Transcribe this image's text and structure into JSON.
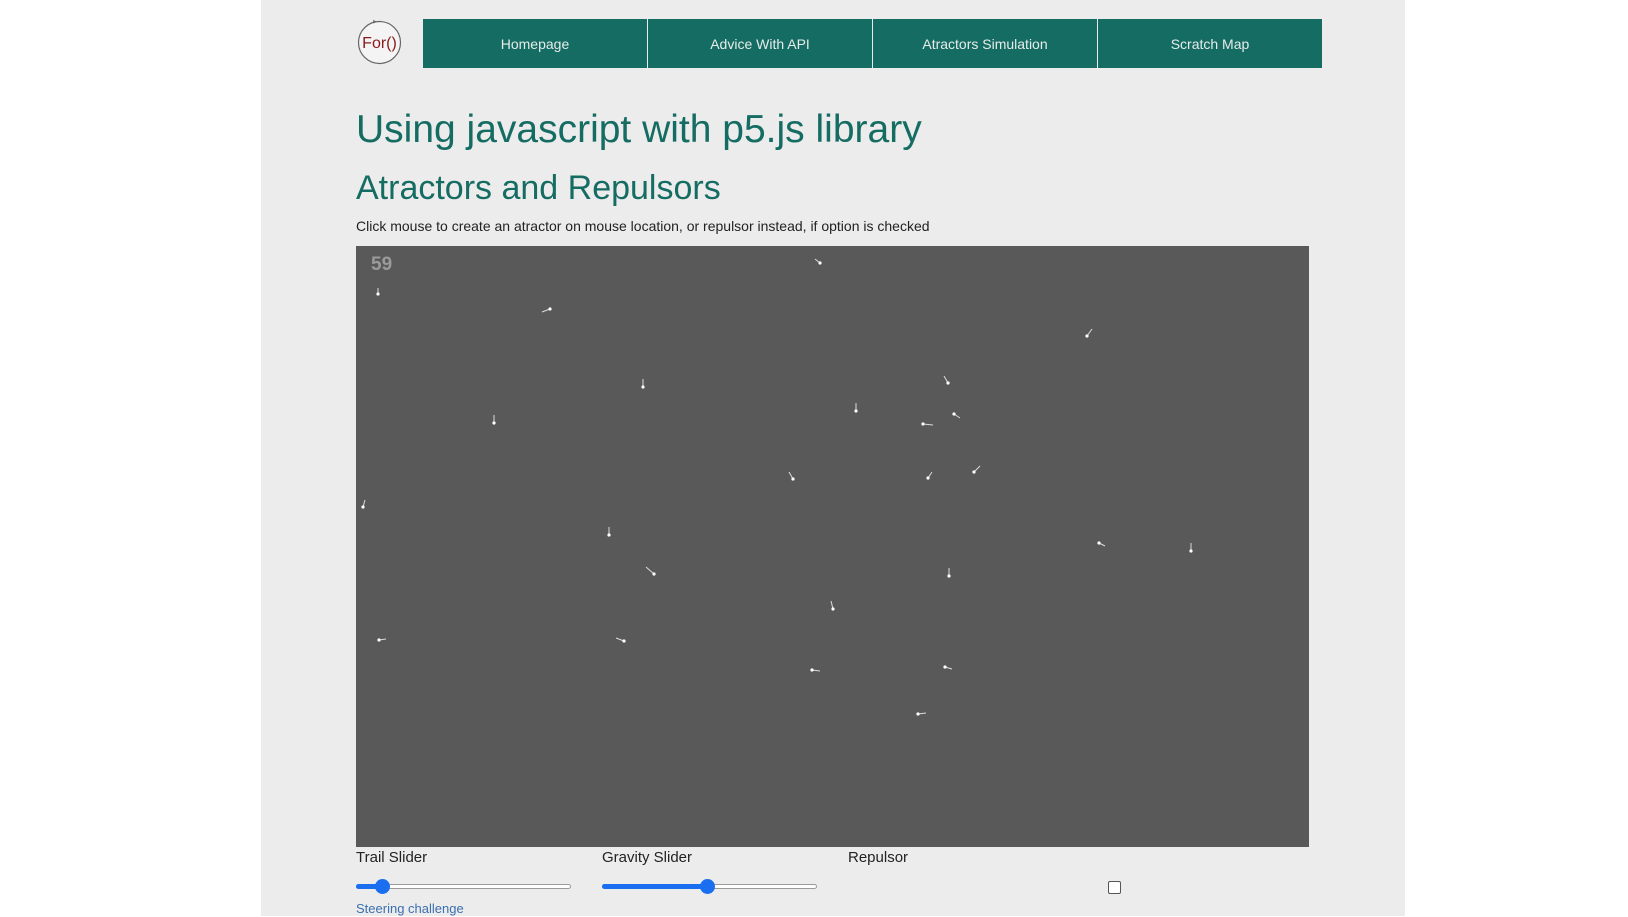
{
  "header": {
    "logo_text": "For()",
    "nav": [
      {
        "label": "Homepage"
      },
      {
        "label": "Advice With API"
      },
      {
        "label": "Atractors Simulation"
      },
      {
        "label": "Scratch Map"
      }
    ]
  },
  "main": {
    "title": "Using javascript with p5.js library",
    "subtitle": "Atractors and Repulsors",
    "instruction": "Click mouse to create an atractor on mouse location, or repulsor instead, if option is checked",
    "canvas": {
      "fps": "59",
      "background_color": "#595959",
      "particle_color": "#ffffff"
    },
    "controls": {
      "trail_label": "Trail Slider",
      "trail_value": 0.12,
      "gravity_label": "Gravity Slider",
      "gravity_value": 0.49,
      "repulsor_label": "Repulsor",
      "repulsor_checked": false
    },
    "link_text": "Steering challenge"
  },
  "colors": {
    "accent": "#156c62",
    "page_bg": "#ececec",
    "slider": "#1a6ff0",
    "link": "#3a6fb0"
  }
}
